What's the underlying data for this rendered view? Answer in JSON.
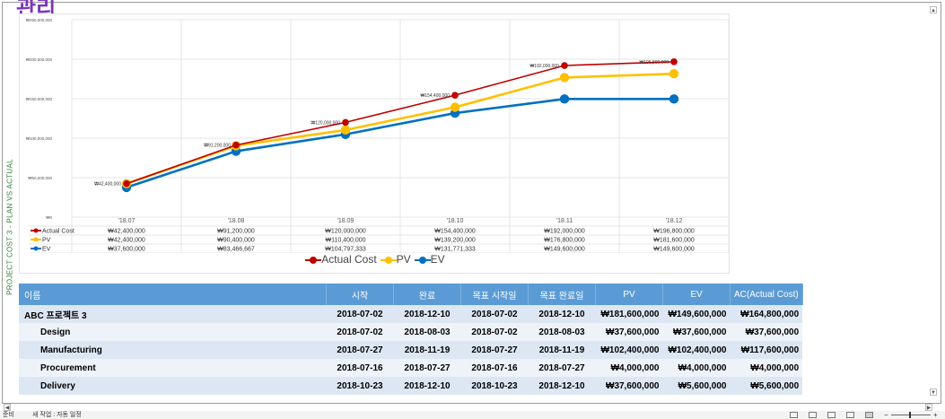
{
  "title_fragment": "관리",
  "side_label": "PROJECT COST 3 - PLAN VS ACTUAL",
  "chart_data": {
    "type": "line",
    "categories": [
      "'18.07",
      "'18.08",
      "'18.09",
      "'18.10",
      "'18.11",
      "'18.12"
    ],
    "ylim": [
      0,
      250000000
    ],
    "yticks": [
      "₩0",
      "₩50,000,000",
      "₩100,000,000",
      "₩150,000,000",
      "₩200,000,000",
      "₩250,000,000"
    ],
    "ytick_values": [
      0,
      50000000,
      100000000,
      150000000,
      200000000,
      250000000
    ],
    "grid": true,
    "legend_position": "bottom",
    "series": [
      {
        "name": "Actual Cost",
        "color": "#c00000",
        "values": [
          42400000,
          91200000,
          120000000,
          154400000,
          192000000,
          196800000
        ],
        "labels": [
          "₩42,400,000",
          "₩91,200,000",
          "₩120,000,000",
          "₩154,400,000",
          "₩192,000,000",
          "₩196,800,000"
        ]
      },
      {
        "name": "PV",
        "color": "#ffc000",
        "values": [
          42400000,
          90400000,
          110400000,
          139200000,
          176800000,
          181600000
        ],
        "labels": [
          "₩42,400,000",
          "₩90,400,000",
          "₩110,400,000",
          "₩139,200,000",
          "₩176,800,000",
          "₩181,600,000"
        ]
      },
      {
        "name": "EV",
        "color": "#0070c0",
        "values": [
          37600000,
          83466667,
          104797333,
          131771333,
          149600000,
          149600000
        ],
        "labels": [
          "₩37,600,000",
          "₩83,466,667",
          "₩104,797,333",
          "₩131,771,333",
          "₩149,600,000",
          "₩149,600,000"
        ]
      }
    ]
  },
  "table": {
    "headers": [
      "이름",
      "시작",
      "완료",
      "목표 시작일",
      "목표 완료일",
      "PV",
      "EV",
      "AC(Actual Cost)"
    ],
    "rows": [
      {
        "cells": [
          "ABC 프로젝트 3",
          "2018-07-02",
          "2018-12-10",
          "2018-07-02",
          "2018-12-10",
          "₩181,600,000",
          "₩149,600,000",
          "₩164,800,000"
        ]
      },
      {
        "cells": [
          "Design",
          "2018-07-02",
          "2018-08-03",
          "2018-07-02",
          "2018-08-03",
          "₩37,600,000",
          "₩37,600,000",
          "₩37,600,000"
        ]
      },
      {
        "cells": [
          "Manufacturing",
          "2018-07-27",
          "2018-11-19",
          "2018-07-27",
          "2018-11-19",
          "₩102,400,000",
          "₩102,400,000",
          "₩117,600,000"
        ]
      },
      {
        "cells": [
          "Procurement",
          "2018-07-16",
          "2018-07-27",
          "2018-07-16",
          "2018-07-27",
          "₩4,000,000",
          "₩4,000,000",
          "₩4,000,000"
        ]
      },
      {
        "cells": [
          "Delivery",
          "2018-10-23",
          "2018-12-10",
          "2018-10-23",
          "2018-12-10",
          "₩37,600,000",
          "₩5,600,000",
          "₩5,600,000"
        ]
      }
    ]
  },
  "statusbar": {
    "ready": "준비",
    "macro": "새 작업 : 자동 일정",
    "zoom_minus": "−",
    "zoom_plus": "+"
  },
  "scroll": {
    "left_arrow": "◀",
    "right_arrow": "▶",
    "up_arrow": "▲",
    "down_arrow": "▼"
  }
}
